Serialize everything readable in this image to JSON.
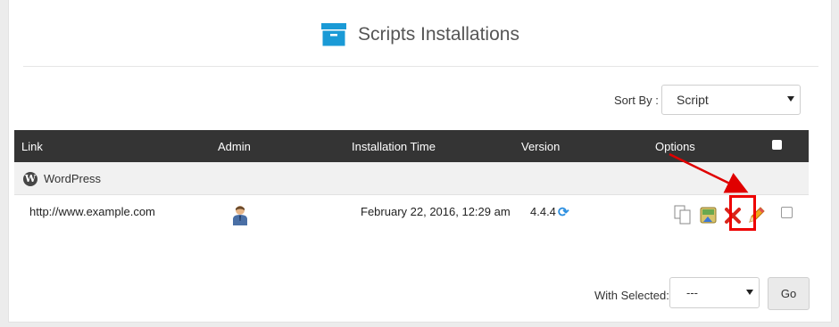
{
  "header": {
    "title": "Scripts Installations",
    "icon": "archive-box-icon",
    "icon_color": "#1a9ad6"
  },
  "sort": {
    "label": "Sort By :",
    "selected": "Script"
  },
  "table": {
    "columns": [
      "Link",
      "Admin",
      "Installation Time",
      "Version",
      "Options"
    ],
    "group": {
      "name": "WordPress",
      "icon": "wordpress-logo-icon"
    },
    "rows": [
      {
        "link": "http://www.example.com",
        "admin_icon": "admin-user-icon",
        "installation_time": "February 22, 2016, 12:29 am",
        "version": "4.4.4",
        "options": [
          "clone-icon",
          "backup-icon",
          "remove-icon",
          "edit-pencil-icon"
        ]
      }
    ]
  },
  "bulk": {
    "label": "With Selected:",
    "selected": "---",
    "go_label": "Go"
  },
  "annotation": {
    "color": "#e00000",
    "target": "edit-pencil-icon"
  }
}
